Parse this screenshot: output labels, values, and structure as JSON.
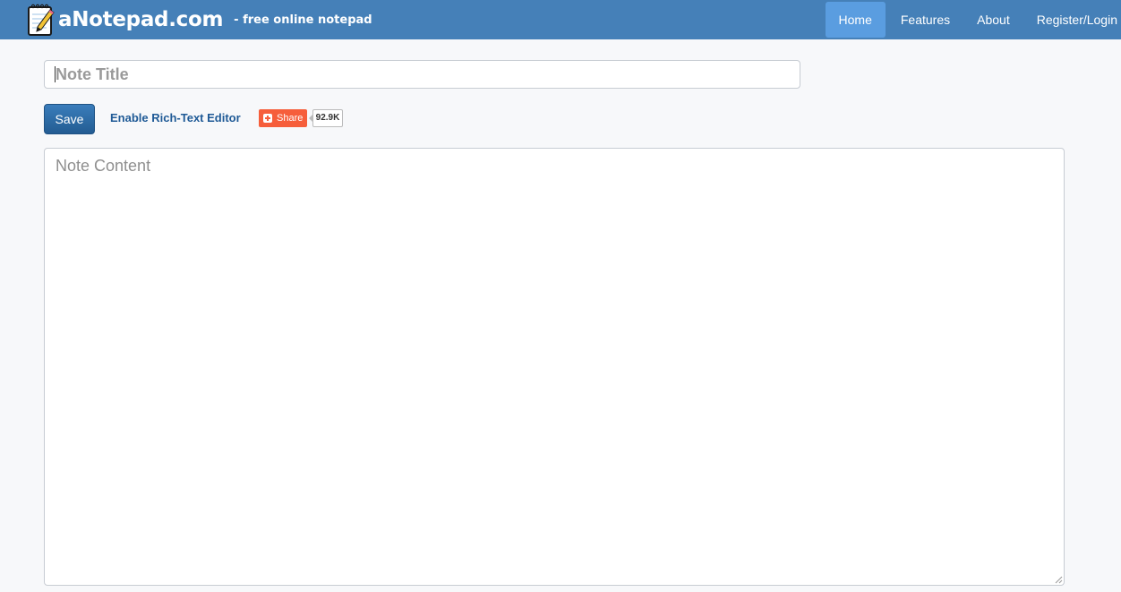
{
  "header": {
    "brand_name": "aNotepad.com",
    "tagline": "- free online notepad",
    "logo_icon": "notepad-pencil-icon",
    "nav": [
      {
        "label": "Home",
        "active": true
      },
      {
        "label": "Features",
        "active": false
      },
      {
        "label": "About",
        "active": false
      },
      {
        "label": "Register/Login",
        "active": false
      }
    ]
  },
  "editor": {
    "title_placeholder": "Note Title",
    "save_label": "Save",
    "rich_text_label": "Enable Rich-Text Editor",
    "share_label": "Share",
    "share_count": "92.9K",
    "content_placeholder": "Note Content"
  },
  "colors": {
    "navbar": "#4580b8",
    "nav_active": "#5a9de0",
    "save_button": "#2d6ba3",
    "share_button": "#f65e3b",
    "link": "#1f5a96"
  }
}
